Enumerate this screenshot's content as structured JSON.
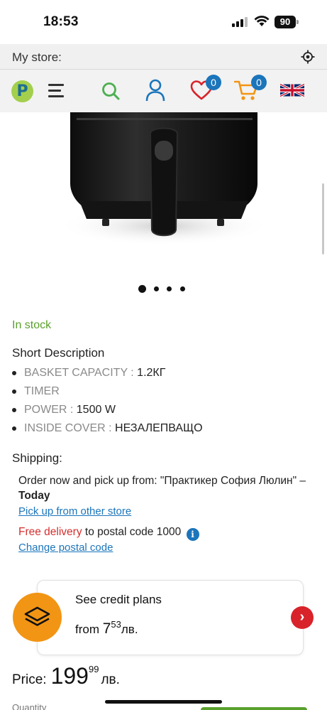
{
  "status_bar": {
    "time": "18:53",
    "battery": "90"
  },
  "store_bar": {
    "label": "My store:",
    "icon": "location-target-icon"
  },
  "header": {
    "logo_letter": "P",
    "wishlist_count": "0",
    "cart_count": "0",
    "icons": [
      "menu-icon",
      "search-icon",
      "user-icon",
      "heart-icon",
      "cart-icon",
      "uk-flag-icon"
    ]
  },
  "gallery": {
    "total_images": 4,
    "active_index": 0
  },
  "product": {
    "stock_status": "In stock",
    "short_description_title": "Short Description",
    "specs": [
      {
        "key": "BASKET CAPACITY : ",
        "value": "1.2КГ"
      },
      {
        "key": "TIMER",
        "value": ""
      },
      {
        "key": "POWER : ",
        "value": "1500 W"
      },
      {
        "key": "INSIDE COVER : ",
        "value": "НЕЗАЛЕПВАЩО"
      }
    ]
  },
  "shipping": {
    "title": "Shipping:",
    "pickup_text": "Order now and pick up from: \"Практикер София Люлин\" – ",
    "pickup_when": "Today",
    "pickup_link": "Pick up from other store",
    "free_delivery": "Free delivery",
    "postal_text": " to postal code 1000",
    "change_postal_link": "Change postal code"
  },
  "credit": {
    "title": "See credit plans",
    "from_label": "from ",
    "amount_main": "7",
    "amount_cents": "53",
    "currency": "лв."
  },
  "price": {
    "label": "Price:",
    "main": "199",
    "cents": "99",
    "currency": "лв."
  },
  "quantity_label": "Quantity",
  "colors": {
    "brand_blue": "#1b75bb",
    "logo_green": "#a3cf4d",
    "stock_green": "#5aa02c",
    "search_green": "#4caf50",
    "cart_orange": "#f29514",
    "heart_red": "#d8232a",
    "free_delivery_red": "#d32f2f"
  }
}
